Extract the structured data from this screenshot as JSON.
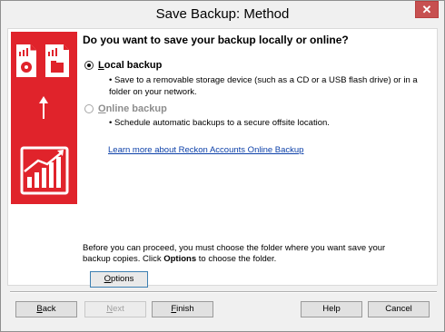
{
  "window": {
    "title": "Save Backup: Method",
    "close_glyph": "✕"
  },
  "heading": "Do you want to save your backup locally or online?",
  "local": {
    "label_first": "L",
    "label_rest": "ocal backup",
    "selected": true,
    "description": "• Save to a removable storage device (such as a CD or a USB flash drive) or in a folder on your network."
  },
  "online": {
    "label_first": "O",
    "label_rest": "nline backup",
    "selected": false,
    "enabled": false,
    "description": "• Schedule automatic backups to a secure offsite location."
  },
  "learn_more_link": "Learn more about  Reckon Accounts Online Backup",
  "note": {
    "before": "Before you can proceed, you must choose the folder where you want save your backup copies. Click ",
    "emphasis": "Options",
    "after": " to choose the folder."
  },
  "options_button": {
    "label_first": "O",
    "label_rest": "ptions"
  },
  "buttons": {
    "back": {
      "first": "B",
      "rest": "ack"
    },
    "next": {
      "first": "N",
      "rest": "ext",
      "enabled": false
    },
    "finish": {
      "first": "F",
      "rest": "inish"
    },
    "help": {
      "label": "Help"
    },
    "cancel": {
      "label": "Cancel"
    }
  },
  "icons": {
    "side_banner": [
      "document-icon",
      "disc-icon",
      "chart-icon",
      "folder-icon",
      "arrow-up-icon",
      "growth-chart-icon"
    ]
  },
  "colors": {
    "brand_red": "#e0232b",
    "link_blue": "#0b3fa8"
  }
}
